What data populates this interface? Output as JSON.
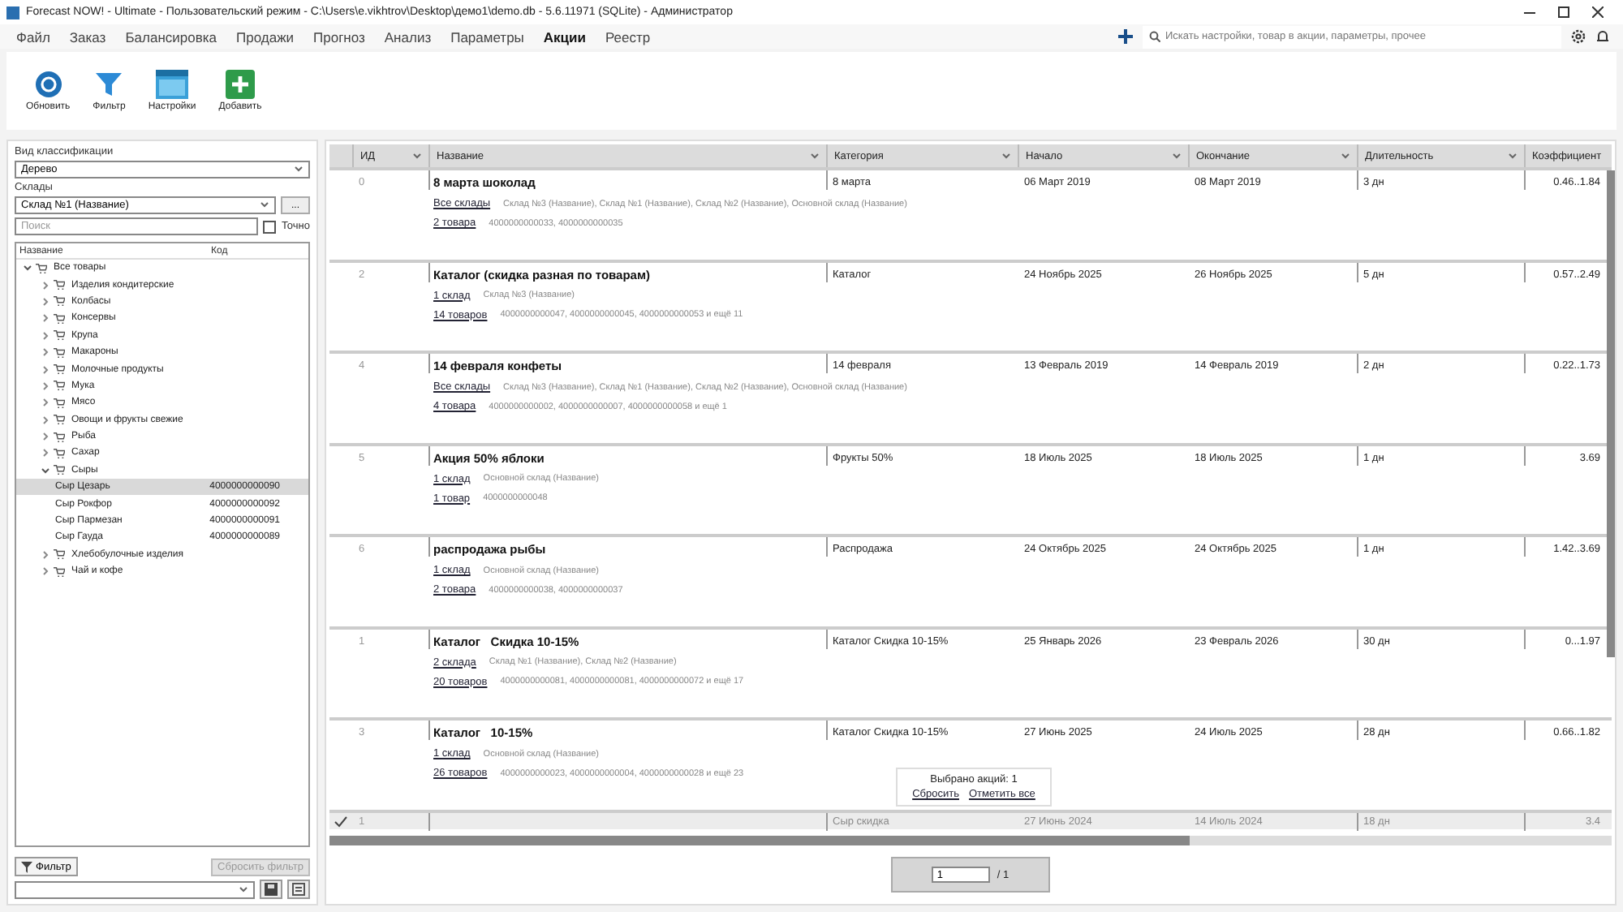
{
  "window": {
    "title": "Forecast NOW! - Ultimate - Пользовательский режим - C:\\Users\\e.vikhtrov\\Desktop\\демо1\\demo.db - 5.6.11971 (SQLite) - Администратор"
  },
  "menu": [
    {
      "label": "Файл",
      "selected": false
    },
    {
      "label": "Заказ",
      "selected": false
    },
    {
      "label": "Балансировка",
      "selected": false
    },
    {
      "label": "Продажи",
      "selected": false
    },
    {
      "label": "Прогноз",
      "selected": false
    },
    {
      "label": "Анализ",
      "selected": false
    },
    {
      "label": "Параметры",
      "selected": false
    },
    {
      "label": "Акции",
      "selected": true
    },
    {
      "label": "Реестр",
      "selected": false
    }
  ],
  "search": {
    "placeholder": "Искать настройки, товар в акции, параметры, прочее"
  },
  "toolbar": [
    {
      "kind": "refresh",
      "label": "Обновить"
    },
    {
      "kind": "filter",
      "label": "Фильтр"
    },
    {
      "kind": "settings",
      "label": "Настройки"
    },
    {
      "kind": "add",
      "label": "Добавить"
    }
  ],
  "left_panel": {
    "classification_label": "Вид классификации",
    "classification_value": "Дерево",
    "stores_label": "Склады",
    "stores_value": "Склад №1 (Название)",
    "more_button": "...",
    "search_placeholder": "Поиск",
    "exact": {
      "label": "Точно",
      "checked": false
    },
    "tree_columns": [
      "Название",
      "Код"
    ],
    "tree": [
      {
        "kind": "group",
        "label": "Все товары",
        "expanded": true,
        "selected": false,
        "children": [
          {
            "kind": "group",
            "label": "Изделия кондитерские",
            "expanded": false,
            "selected": false
          },
          {
            "kind": "group",
            "label": "Колбасы",
            "expanded": false,
            "selected": false
          },
          {
            "kind": "group",
            "label": "Консервы",
            "expanded": false,
            "selected": false
          },
          {
            "kind": "group",
            "label": "Крупа",
            "expanded": false,
            "selected": false
          },
          {
            "kind": "group",
            "label": "Макароны",
            "expanded": false,
            "selected": false
          },
          {
            "kind": "group",
            "label": "Молочные продукты",
            "expanded": false,
            "selected": false
          },
          {
            "kind": "group",
            "label": "Мука",
            "expanded": false,
            "selected": false
          },
          {
            "kind": "group",
            "label": "Мясо",
            "expanded": false,
            "selected": false
          },
          {
            "kind": "group",
            "label": "Овощи и фрукты свежие",
            "expanded": false,
            "selected": false
          },
          {
            "kind": "group",
            "label": "Рыба",
            "expanded": false,
            "selected": false
          },
          {
            "kind": "group",
            "label": "Сахар",
            "expanded": false,
            "selected": false
          },
          {
            "kind": "group",
            "label": "Сыры",
            "expanded": true,
            "selected": false,
            "children": [
              {
                "kind": "item",
                "label": "Сыр Цезарь",
                "code": "4000000000090",
                "selected": true
              },
              {
                "kind": "item",
                "label": "Сыр Рокфор",
                "code": "4000000000092",
                "selected": false
              },
              {
                "kind": "item",
                "label": "Сыр Пармезан",
                "code": "4000000000091",
                "selected": false
              },
              {
                "kind": "item",
                "label": "Сыр Гауда",
                "code": "4000000000089",
                "selected": false
              }
            ]
          },
          {
            "kind": "group",
            "label": "Хлебобулочные изделия",
            "expanded": false,
            "selected": false
          },
          {
            "kind": "group",
            "label": "Чай и кофе",
            "expanded": false,
            "selected": false
          }
        ]
      }
    ],
    "filter_button": "Фильтр",
    "reset_button": {
      "label": "Сбросить фильтр",
      "disabled": true
    }
  },
  "table": {
    "columns": [
      "ИД",
      "Название",
      "Категория",
      "Начало",
      "Окончание",
      "Длительность",
      "Коэффициент"
    ],
    "rows": [
      {
        "id": "0",
        "name": "8 марта шоколад",
        "stores_link": "Все склады",
        "stores": "Склад №3 (Название), Склад №1 (Название), Склад №2 (Название), Основной склад (Название)",
        "goods_link": "2 товара",
        "goods": "4000000000033, 4000000000035",
        "category": "8 марта",
        "start": "06 Март 2019",
        "end": "08 Март 2019",
        "duration": "3 дн",
        "coef": "0.46..1.84",
        "checked": false,
        "selected": false
      },
      {
        "id": "2",
        "name": "Каталог (скидка разная по товарам)",
        "stores_link": "1 склад",
        "stores": "Склад №3 (Название)",
        "goods_link": "14 товаров",
        "goods": "4000000000047, 4000000000045, 4000000000053 и ещё 11",
        "category": "Каталог",
        "start": "24 Ноябрь 2025",
        "end": "26 Ноябрь 2025",
        "duration": "5 дн",
        "coef": "0.57..2.49",
        "checked": false,
        "selected": false
      },
      {
        "id": "4",
        "name": "14 февраля конфеты",
        "stores_link": "Все склады",
        "stores": "Склад №3 (Название), Склад №1 (Название), Склад №2 (Название), Основной склад (Название)",
        "goods_link": "4 товара",
        "goods": "4000000000002, 4000000000007, 4000000000058 и ещё 1",
        "category": "14 февраля",
        "start": "13 Февраль 2019",
        "end": "14 Февраль 2019",
        "duration": "2 дн",
        "coef": "0.22..1.73",
        "checked": false,
        "selected": false
      },
      {
        "id": "5",
        "name": "Акция 50% яблоки",
        "stores_link": "1 склад",
        "stores": "Основной склад (Название)",
        "goods_link": "1 товар",
        "goods": "4000000000048",
        "category": "Фрукты 50%",
        "start": "18 Июль 2025",
        "end": "18 Июль 2025",
        "duration": "1 дн",
        "coef": "3.69",
        "checked": false,
        "selected": false
      },
      {
        "id": "6",
        "name": "распродажа рыбы",
        "stores_link": "1 склад",
        "stores": "Основной склад (Название)",
        "goods_link": "2 товара",
        "goods": "4000000000038, 4000000000037",
        "category": "Распродажа",
        "start": "24 Октябрь 2025",
        "end": "24 Октябрь 2025",
        "duration": "1 дн",
        "coef": "1.42..3.69",
        "checked": false,
        "selected": false
      },
      {
        "id": "1",
        "name": "Каталог   Скидка 10-15%",
        "stores_link": "2 склада",
        "stores": "Склад №1 (Название), Склад №2 (Название)",
        "goods_link": "20 товаров",
        "goods": "4000000000081, 4000000000081, 4000000000072 и ещё 17",
        "category": "Каталог Скидка 10-15%",
        "start": "25 Январь 2026",
        "end": "23 Февраль 2026",
        "duration": "30 дн",
        "coef": "0...1.97",
        "checked": false,
        "selected": false
      },
      {
        "id": "3",
        "name": "Каталог   10-15%",
        "stores_link": "1 склад",
        "stores": "Основной склад (Название)",
        "goods_link": "26 товаров",
        "goods": "4000000000023, 4000000000004, 4000000000028 и ещё 23",
        "category": "Каталог Скидка 10-15%",
        "start": "27 Июнь 2025",
        "end": "24 Июль 2025",
        "duration": "28 дн",
        "coef": "0.66..1.82",
        "checked": false,
        "selected": false
      },
      {
        "id": "1",
        "category": "Сыр скидка",
        "start": "27 Июнь 2024",
        "end": "14 Июль 2024",
        "duration": "18 дн",
        "coef": "3.4",
        "checked": true,
        "selected": true
      }
    ]
  },
  "selection_popup": {
    "text": "Выбрано акций: 1",
    "reset_link": "Сбросить",
    "select_all_link": "Отметить все"
  },
  "pager": {
    "page": "1",
    "total": "/ 1"
  }
}
